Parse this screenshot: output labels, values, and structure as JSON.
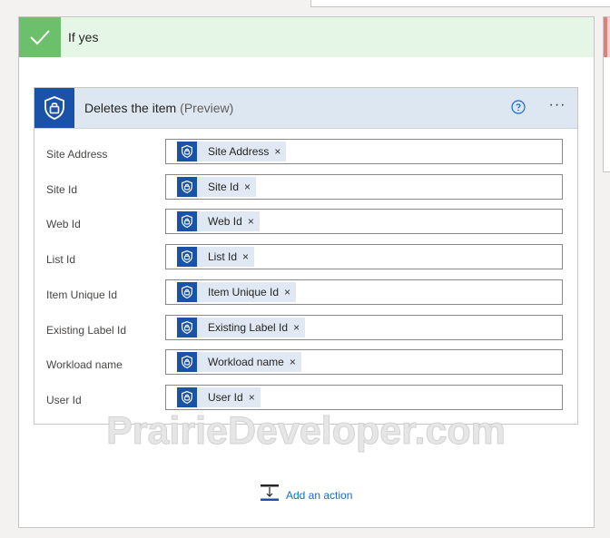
{
  "branch": {
    "title": "If yes"
  },
  "action": {
    "title": "Deletes the item",
    "preview": "(Preview)",
    "more_label": "···"
  },
  "fields": [
    {
      "label": "Site Address",
      "token": "Site Address"
    },
    {
      "label": "Site Id",
      "token": "Site Id"
    },
    {
      "label": "Web Id",
      "token": "Web Id"
    },
    {
      "label": "List Id",
      "token": "List Id"
    },
    {
      "label": "Item Unique Id",
      "token": "Item Unique Id"
    },
    {
      "label": "Existing Label Id",
      "token": "Existing Label Id"
    },
    {
      "label": "Workload name",
      "token": "Workload name"
    },
    {
      "label": "User Id",
      "token": "User Id"
    }
  ],
  "token_remove": "×",
  "add_action": {
    "label": "Add an action"
  },
  "watermark": "PrairieDeveloper.com",
  "colors": {
    "branch_header_bg": "#e6f6e6",
    "check_bg": "#6cc06c",
    "action_header_bg": "#dde7f2",
    "connector_blue": "#1a52a8",
    "token_bg": "#dfe8f3",
    "link_blue": "#1a6ac9"
  },
  "icons": {
    "branch": "checkmark-icon",
    "action": "shield-lock-icon",
    "token": "shield-lock-icon",
    "help": "question-circle-icon",
    "add_action": "add-action-icon"
  }
}
